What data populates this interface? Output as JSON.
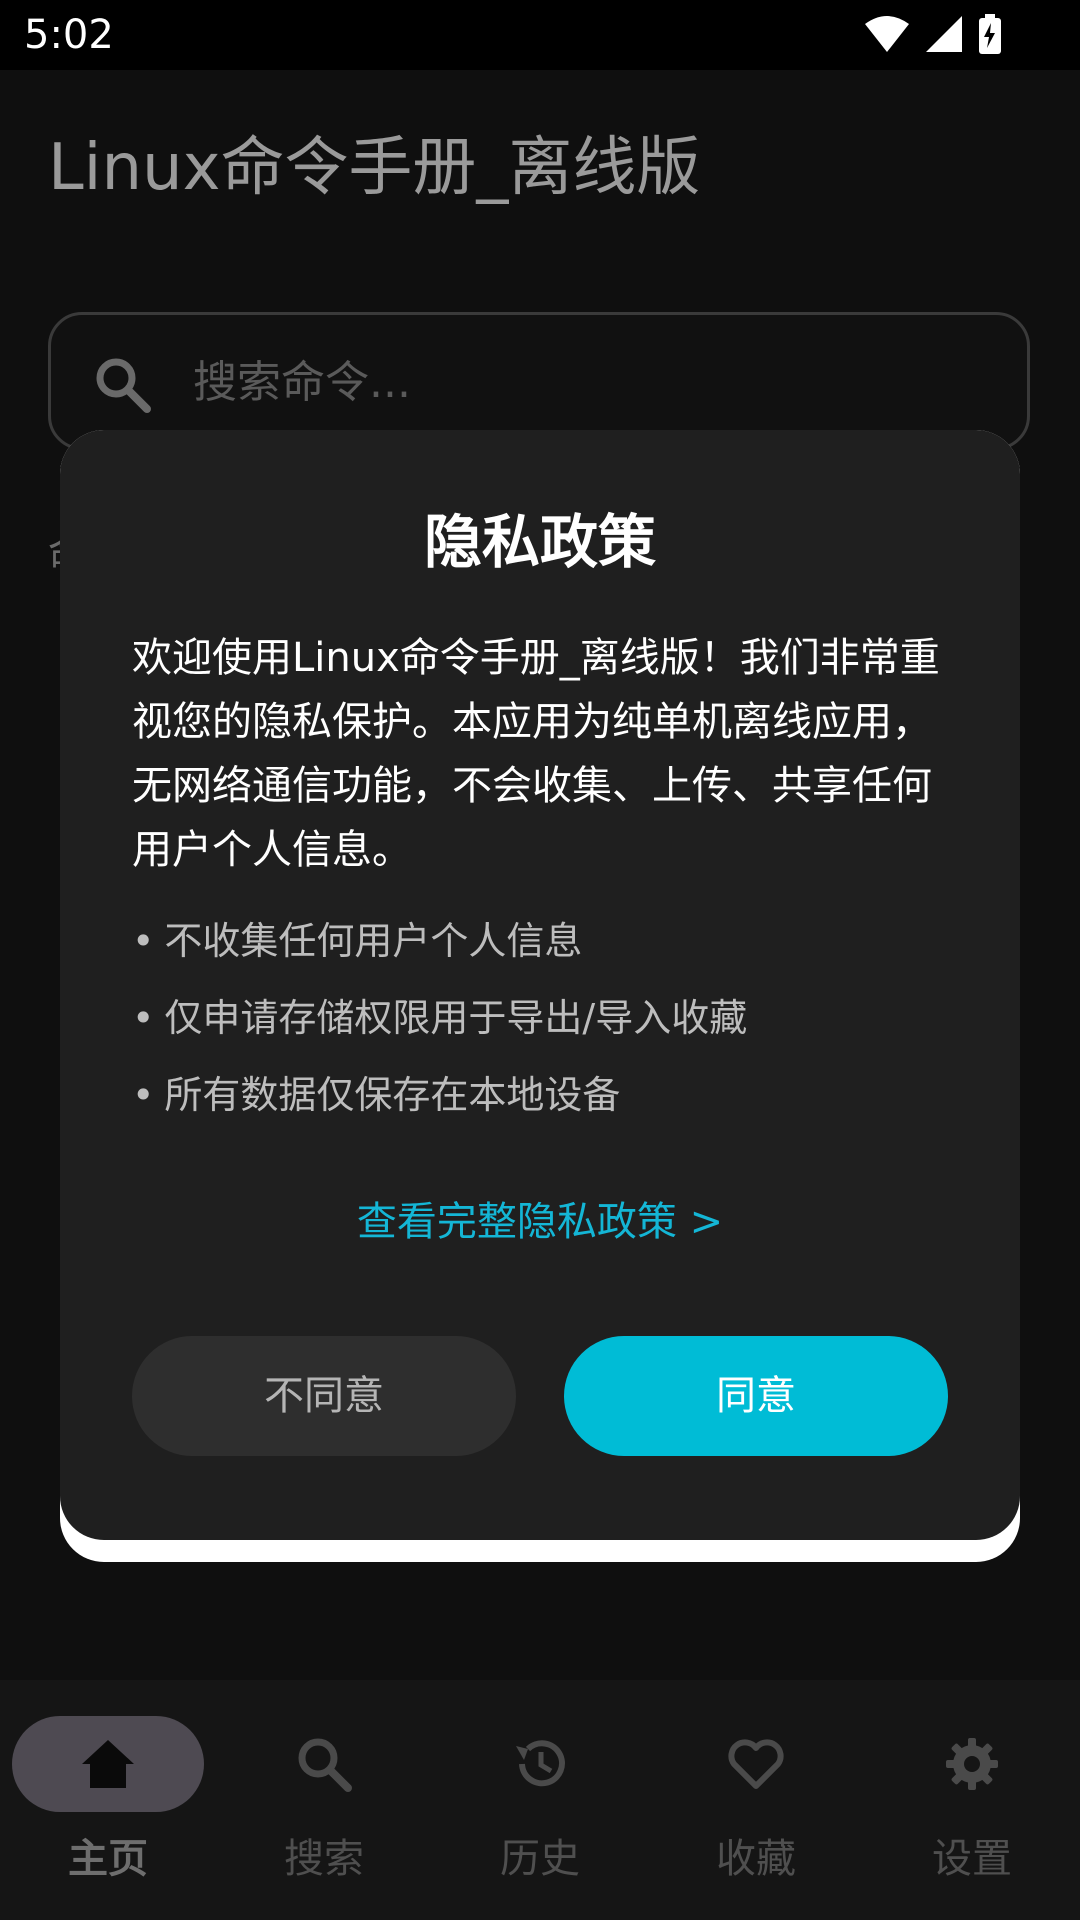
{
  "status_bar": {
    "time": "5:02",
    "icons": [
      "wifi-icon",
      "signal-icon",
      "battery-charging-icon"
    ]
  },
  "app": {
    "title": "Linux命令手册_离线版",
    "search_placeholder": "搜索命令...",
    "background_fragment": "命"
  },
  "dialog": {
    "title": "隐私政策",
    "intro": "欢迎使用Linux命令手册_离线版！我们非常重视您的隐私保护。本应用为纯单机离线应用，无网络通信功能，不会收集、上传、共享任何用户个人信息。",
    "bullets": [
      "不收集任何用户个人信息",
      "仅申请存储权限用于导出/导入收藏",
      "所有数据仅保存在本地设备"
    ],
    "bullet_mark": "•",
    "link": "查看完整隐私政策 >",
    "disagree": "不同意",
    "agree": "同意"
  },
  "bottom_nav": {
    "items": [
      {
        "label": "主页",
        "icon": "home-icon",
        "active": true
      },
      {
        "label": "搜索",
        "icon": "search-icon",
        "active": false
      },
      {
        "label": "历史",
        "icon": "history-icon",
        "active": false
      },
      {
        "label": "收藏",
        "icon": "heart-icon",
        "active": false
      },
      {
        "label": "设置",
        "icon": "gear-icon",
        "active": false
      }
    ]
  },
  "colors": {
    "accent": "#00bcd6",
    "link": "#14b6d6",
    "dialog_bg": "#1f1f1f"
  }
}
